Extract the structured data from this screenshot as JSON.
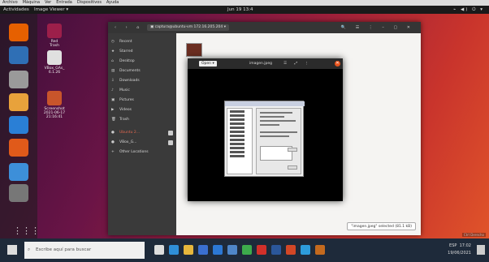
{
  "host_menu": [
    "Archivo",
    "Máquina",
    "Ver",
    "Entrada",
    "Dispositivos",
    "Ayuda"
  ],
  "top_bar": {
    "activities": "Actividades",
    "app_menu": "Image Viewer ▾",
    "clock": "Jun 19 13:4",
    "tray": "⌁ ◀) ⏻ ▾"
  },
  "dock": {
    "apps_grid": "⋮⋮⋮",
    "icons": [
      {
        "name": "firefox-icon",
        "color": "#e66000"
      },
      {
        "name": "thunderbird-icon",
        "color": "#2f6fb5"
      },
      {
        "name": "files-icon",
        "color": "#9a9a9a"
      },
      {
        "name": "rhythmbox-icon",
        "color": "#e8a23b"
      },
      {
        "name": "writer-icon",
        "color": "#2a7fd6"
      },
      {
        "name": "software-icon",
        "color": "#e05a1a"
      },
      {
        "name": "help-icon",
        "color": "#3d8fd9"
      },
      {
        "name": "terminal-icon",
        "color": "#777"
      }
    ]
  },
  "desktop_icons": [
    {
      "label": "Red",
      "sub": "Trash",
      "color": "#9c1f4a"
    },
    {
      "label": "VBox_GAs_",
      "sub": "6.1.26",
      "color": "#e0e0e0"
    },
    {
      "label": "Screenshot",
      "sub": "2021-06-17 21:16:41",
      "color": "#c8552b"
    }
  ],
  "files_window": {
    "nav": "‹ › ⌂",
    "path": "▣ captura@ubuntu-vm 172.16.205.204 ▾",
    "tools": "🔍 ☰ ⋮ – ▢ ✕",
    "sidebar": [
      {
        "icon": "◷",
        "label": "Recent",
        "color_class": ""
      },
      {
        "icon": "★",
        "label": "Starred",
        "color_class": ""
      },
      {
        "icon": "⌂",
        "label": "Desktop",
        "color_class": ""
      },
      {
        "icon": "▤",
        "label": "Documents",
        "color_class": ""
      },
      {
        "icon": "⇩",
        "label": "Downloads",
        "color_class": ""
      },
      {
        "icon": "♪",
        "label": "Music",
        "color_class": ""
      },
      {
        "icon": "▣",
        "label": "Pictures",
        "color_class": ""
      },
      {
        "icon": "▶",
        "label": "Videos",
        "color_class": ""
      },
      {
        "icon": "🗑",
        "label": "Trash",
        "color_class": ""
      },
      {
        "icon": "●",
        "label": "Ubuntu 2...",
        "color_class": "red"
      },
      {
        "icon": "●",
        "label": "VBox_G...",
        "color_class": ""
      },
      {
        "icon": "+",
        "label": "Other Locations",
        "color_class": ""
      }
    ],
    "status": "\"imagen.jpeg\" selected (81.1 kB)"
  },
  "viewer": {
    "open_label": "Open ▾",
    "title": "imagen.jpeg",
    "tools": "☰ ⤢ ⋮",
    "close": "✕"
  },
  "taskbar": {
    "search_placeholder": "Escribe aquí para buscar",
    "search_icon": "⌕",
    "icons": [
      {
        "name": "task-view-icon",
        "color": "#ddd"
      },
      {
        "name": "edge-icon",
        "color": "#2f8fd8"
      },
      {
        "name": "explorer-icon",
        "color": "#e7b73c"
      },
      {
        "name": "store-icon",
        "color": "#3a6fd0"
      },
      {
        "name": "mail-icon",
        "color": "#2c78d4"
      },
      {
        "name": "virtualbox-icon",
        "color": "#4f86c8"
      },
      {
        "name": "chrome-icon",
        "color": "#3dab4c"
      },
      {
        "name": "acrobat-icon",
        "color": "#d2302a"
      },
      {
        "name": "word-icon",
        "color": "#2b579a"
      },
      {
        "name": "powerpoint-icon",
        "color": "#d24726"
      },
      {
        "name": "app-icon",
        "color": "#2d9cdb"
      },
      {
        "name": "settings-icon",
        "color": "#c46a1e"
      }
    ],
    "time": "17:02",
    "date": "19/06/2021",
    "lang": "ESP"
  },
  "host_status": "Ctrl Derecho"
}
